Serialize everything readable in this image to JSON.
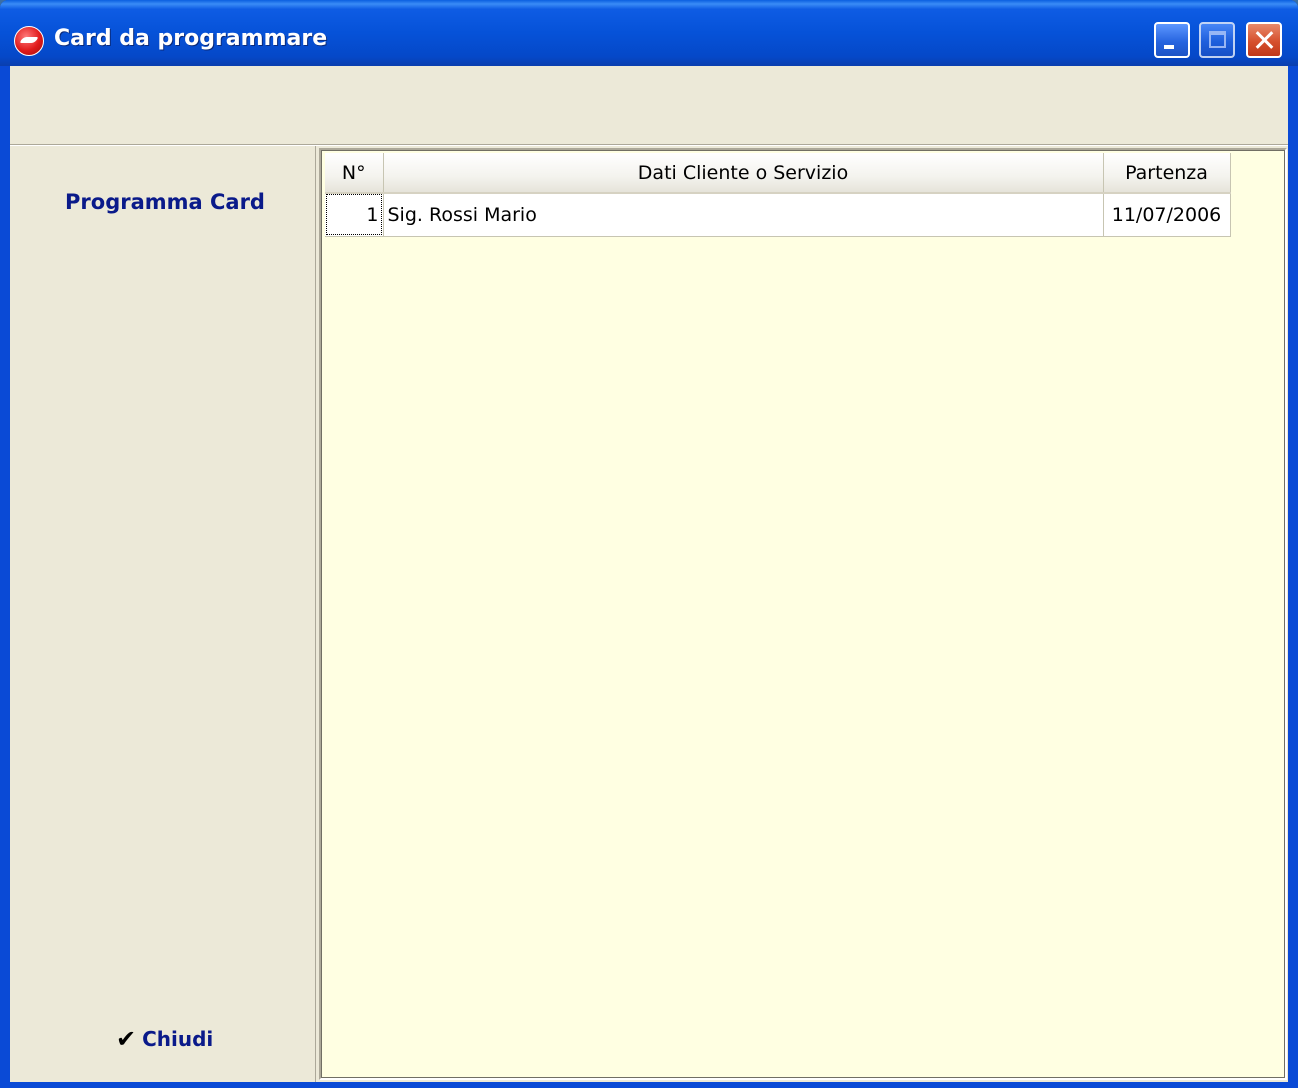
{
  "window": {
    "title": "Card da programmare"
  },
  "sidebar": {
    "title": "Programma Card",
    "close_label": "Chiudi"
  },
  "grid": {
    "columns": [
      "N°",
      "Dati Cliente o Servizio",
      "Partenza"
    ],
    "rows": [
      {
        "num": "1",
        "data": "Sig. Rossi Mario",
        "date": "11/07/2006"
      }
    ]
  }
}
